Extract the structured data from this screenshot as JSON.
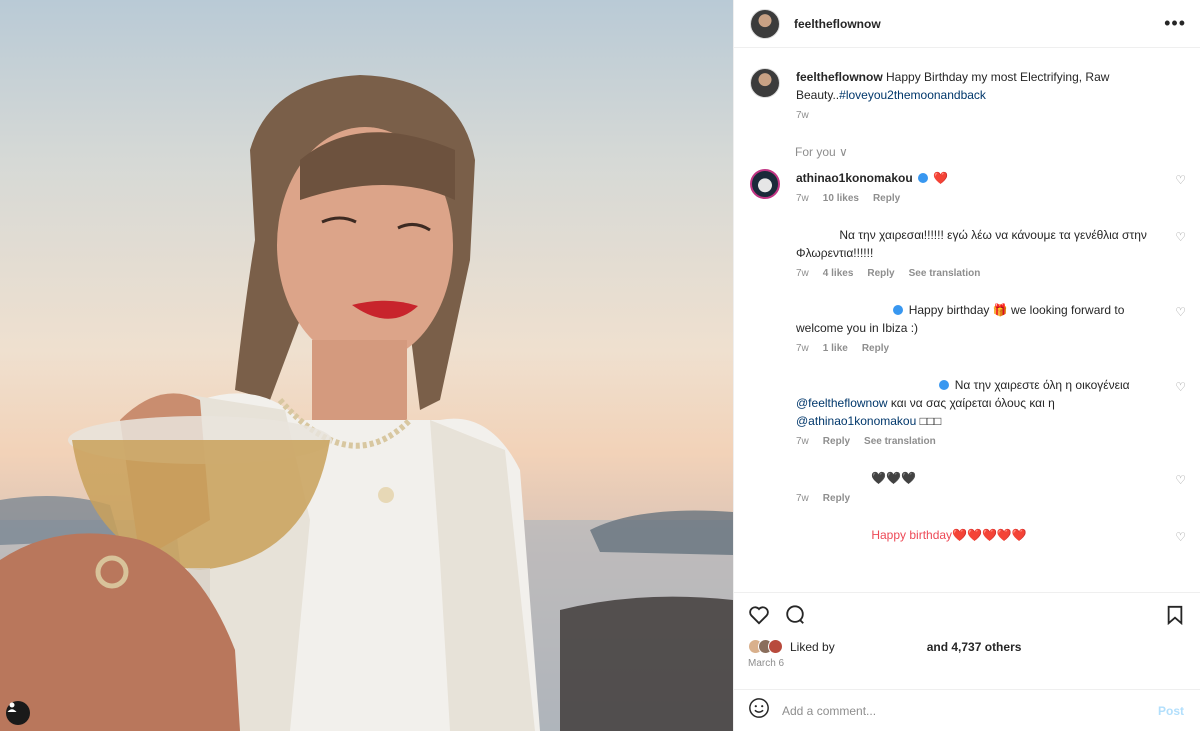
{
  "post": {
    "username": "feeltheflownow",
    "more_icon": "more-horizontal-icon",
    "user_tag_icon": "user-tag-icon"
  },
  "caption": {
    "username": "feeltheflownow",
    "text": "Happy Birthday my most Electrifying, Raw Beauty..",
    "hashtag": "#loveyou2themoonandback",
    "time": "7w"
  },
  "for_you": "For you ∨",
  "comments": [
    {
      "username": "athinao1konomakou",
      "text": "❤️",
      "time": "7w",
      "likes": "10 likes",
      "reply": "Reply"
    },
    {
      "username": "",
      "text": "Να την χαιρεσαι!!!!!! εγώ λέω να κάνουμε τα γενέθλια στην Φλωρεντια!!!!!!",
      "time": "7w",
      "likes": "4 likes",
      "reply": "Reply",
      "translate": "See translation"
    },
    {
      "username": "",
      "text": "Happy birthday 🎁 we looking forward to welcome you in Ibiza :)",
      "time": "7w",
      "likes": "1 like",
      "reply": "Reply"
    },
    {
      "username": "",
      "text_a": "Να την χαιρεστε όλη η οικογένεια",
      "mention_1": "@feeltheflownow",
      "text_b": "και να σας χαίρεται όλους και η",
      "mention_2": "@athinao1konomakou",
      "text_c": "□□□",
      "time": "7w",
      "reply": "Reply",
      "translate": "See translation"
    },
    {
      "username": "",
      "text": "🖤🖤🖤",
      "time": "7w",
      "reply": "Reply"
    },
    {
      "username": "",
      "text": "Happy birthday❤️❤️❤️❤️❤️"
    }
  ],
  "actions": {
    "like_icon": "heart-icon",
    "comment_icon": "comment-icon",
    "save_icon": "bookmark-icon",
    "liked_by": "Liked by",
    "others": "and 4,737 others",
    "date": "March 6"
  },
  "add_comment": {
    "placeholder": "Add a comment...",
    "post_label": "Post",
    "emoji_icon": "emoji-icon"
  },
  "colors": {
    "link": "#00376b",
    "muted": "#8e8e8e",
    "verified": "#3897f0",
    "heart": "#ed4956"
  }
}
